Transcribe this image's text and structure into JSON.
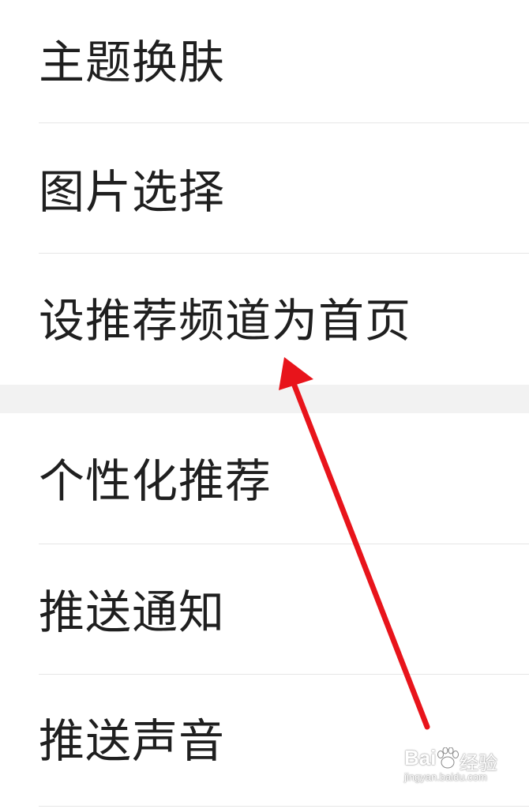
{
  "settings": {
    "group1": [
      {
        "label": "主题换肤"
      },
      {
        "label": "图片选择"
      },
      {
        "label": "设推荐频道为首页"
      }
    ],
    "group2": [
      {
        "label": "个性化推荐"
      },
      {
        "label": "推送通知"
      },
      {
        "label": "推送声音"
      }
    ]
  },
  "annotation": {
    "arrow_color": "#e8141b"
  },
  "watermark": {
    "brand_prefix": "Bai",
    "brand_suffix": "经验",
    "url": "jingyan.baidu.com"
  }
}
